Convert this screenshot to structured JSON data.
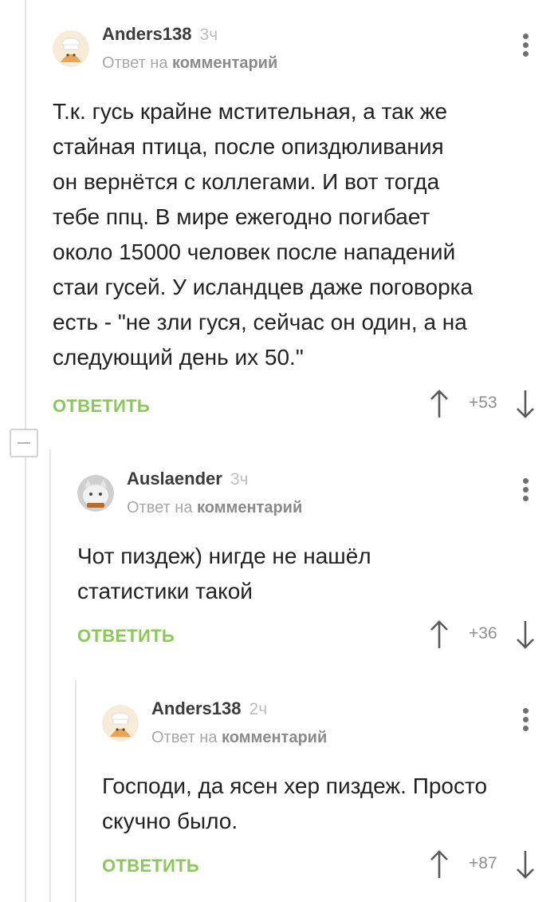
{
  "comments": [
    {
      "author": "Anders138",
      "time": "3ч",
      "reply_prefix": "Ответ на",
      "reply_target": "комментарий",
      "body": "Т.к. гусь крайне мстительная, а так же\nстайная птица, после опиздюливания\nон вернётся с коллегами. И вот тогда\nтебе ппц. В мире ежегодно погибает\nоколо 15000 человек после нападений\nстаи гусей. У исландцев даже поговорка\nесть - \"не зли гуся, сейчас он один, а на\nследующий день их 50.\"",
      "reply_label": "ОТВЕТИТЬ",
      "rating": "+53"
    },
    {
      "author": "Auslaender",
      "time": "3ч",
      "reply_prefix": "Ответ на",
      "reply_target": "комментарий",
      "body": "Чот пиздеж) нигде не нашёл\nстатистики такой",
      "reply_label": "ОТВЕТИТЬ",
      "rating": "+36"
    },
    {
      "author": "Anders138",
      "time": "2ч",
      "reply_prefix": "Ответ на",
      "reply_target": "комментарий",
      "body": "Господи, да ясен хер пиздеж. Просто\nскучно было.",
      "reply_label": "ОТВЕТИТЬ",
      "rating": "+87"
    }
  ],
  "icons": {
    "menu": "more-vertical-icon",
    "up": "arrow-up-icon",
    "down": "arrow-down-icon",
    "collapse": "minus-icon"
  },
  "colors": {
    "reply_green": "#8ac858",
    "thread_line": "#e6e6e6"
  }
}
